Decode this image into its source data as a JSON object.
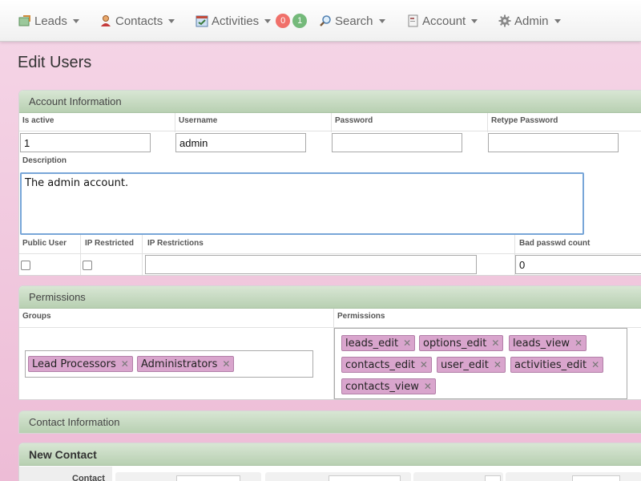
{
  "navbar": {
    "items": [
      {
        "label": "Leads",
        "icon": "leads-icon"
      },
      {
        "label": "Contacts",
        "icon": "contacts-icon"
      },
      {
        "label": "Activities",
        "icon": "activities-icon",
        "badges": [
          "0",
          "1"
        ]
      },
      {
        "label": "Search",
        "icon": "search-icon"
      },
      {
        "label": "Account",
        "icon": "account-icon"
      },
      {
        "label": "Admin",
        "icon": "gear-icon"
      }
    ]
  },
  "page": {
    "title": "Edit Users"
  },
  "account_info": {
    "header": "Account Information",
    "labels": {
      "is_active": "Is active",
      "username": "Username",
      "password": "Password",
      "retype_password": "Retype Password",
      "description": "Description",
      "public_user": "Public User",
      "ip_restricted": "IP Restricted",
      "ip_restrictions": "IP Restrictions",
      "bad_passwd_count": "Bad passwd count"
    },
    "values": {
      "is_active": "1",
      "username": "admin",
      "password": "",
      "retype_password": "",
      "description": "The admin account.",
      "ip_restrictions": "",
      "bad_passwd_count": "0"
    }
  },
  "permissions": {
    "header": "Permissions",
    "labels": {
      "groups": "Groups",
      "permissions": "Permissions"
    },
    "groups": [
      "Lead Processors",
      "Administrators"
    ],
    "permissions": [
      "leads_edit",
      "options_edit",
      "leads_view",
      "contacts_edit",
      "user_edit",
      "activities_edit",
      "contacts_view"
    ]
  },
  "contact_info": {
    "header": "Contact Information"
  },
  "new_contact": {
    "header": "New Contact",
    "row_label": "Contact"
  },
  "colors": {
    "badge_red": "#f0706a",
    "badge_green": "#74b97a",
    "tag_bg": "#d9a5cd",
    "panel_head": "#c4d9bf"
  }
}
